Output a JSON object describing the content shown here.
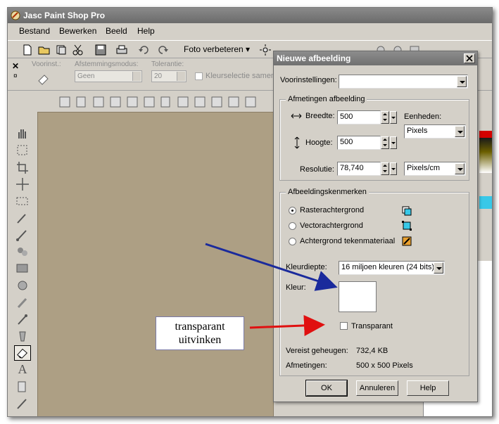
{
  "app": {
    "title": "Jasc Paint Shop Pro",
    "menu": [
      "Bestand",
      "Bewerken",
      "Beeld",
      "Help"
    ],
    "toolbar": {
      "enhance_label": "Foto verbeteren ▾"
    },
    "options": {
      "preset_label": "Voorinst.:",
      "blend_label": "Afstemmingsmodus:",
      "blend_value": "Geen",
      "tolerance_label": "Tolerantie:",
      "tolerance_value": "20",
      "merge_label": "Kleurselectie samengev"
    },
    "canvas_color": "#ad9f84"
  },
  "dialog": {
    "title": "Nieuwe afbeelding",
    "presets_label": "Voorinstellingen:",
    "presets_value": "",
    "dimensions_group": "Afmetingen afbeelding",
    "width_label": "Breedte:",
    "width_value": "500",
    "height_label": "Hoogte:",
    "height_value": "500",
    "resolution_label": "Resolutie:",
    "resolution_value": "78,740",
    "units_label": "Eenheden:",
    "units_value": "Pixels",
    "resolution_units_value": "Pixels/cm",
    "characteristics_group": "Afbeeldingskenmerken",
    "raster_label": "Rasterachtergrond",
    "vector_label": "Vectorachtergrond",
    "material_label": "Achtergrond tekenmateriaal",
    "selected_background": "raster",
    "color_depth_label": "Kleurdiepte:",
    "color_depth_value": "16 miljoen kleuren (24 bits)",
    "color_label": "Kleur:",
    "color_value": "#ffffff",
    "transparent_label": "Transparant",
    "transparent_checked": false,
    "memory_label": "Vereist geheugen:",
    "memory_value": "732,4 KB",
    "dimensions_label": "Afmetingen:",
    "dimensions_value": "500 x 500 Pixels",
    "ok_label": "OK",
    "cancel_label": "Annuleren",
    "help_label": "Help"
  },
  "annotation": {
    "line1": "transparant",
    "line2": "uitvinken",
    "blue_arrow_color": "#1a2a9c",
    "red_arrow_color": "#e01010"
  }
}
